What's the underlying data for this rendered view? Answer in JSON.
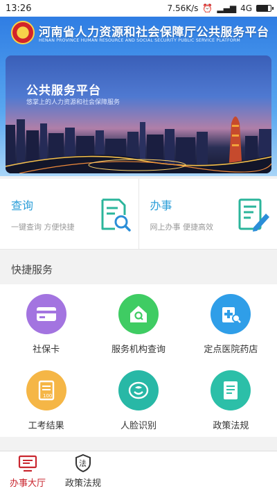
{
  "status_bar": {
    "time": "13:26",
    "speed": "7.56K/s",
    "network": "4G"
  },
  "header": {
    "title": "河南省人力资源和社会保障厅公共服务平台",
    "subtitle": "HENAN PROVINCE HUMAN RESOURCE AND SOCIAL SECURITY PUBLIC SERVICE PLATFORM"
  },
  "banner": {
    "title": "公共服务平台",
    "subtitle": "悠掌上的人力资源和社会保障服务"
  },
  "cards": [
    {
      "title": "查询",
      "desc": "一键查询 方便快捷",
      "icon": "search-document-icon"
    },
    {
      "title": "办事",
      "desc": "网上办事 便捷高效",
      "icon": "edit-document-icon"
    }
  ],
  "quick": {
    "title": "快捷服务",
    "items": [
      {
        "label": "社保卡",
        "icon": "card-icon",
        "color": "#a374e0"
      },
      {
        "label": "服务机构查询",
        "icon": "house-search-icon",
        "color": "#3fcc63"
      },
      {
        "label": "定点医院药店",
        "icon": "hospital-icon",
        "color": "#2f9ee8"
      },
      {
        "label": "工考结果",
        "icon": "exam-result-icon",
        "color": "#f5b646"
      },
      {
        "label": "人脸识别",
        "icon": "face-recognition-icon",
        "color": "#28b8a6"
      },
      {
        "label": "政策法规",
        "icon": "policy-document-icon",
        "color": "#2cbfa8"
      }
    ]
  },
  "tabs": [
    {
      "label": "办事大厅",
      "active": true
    },
    {
      "label": "政策法规",
      "active": false
    }
  ],
  "colors": {
    "accent": "#2b9ed8",
    "tab_active": "#c9262f"
  }
}
